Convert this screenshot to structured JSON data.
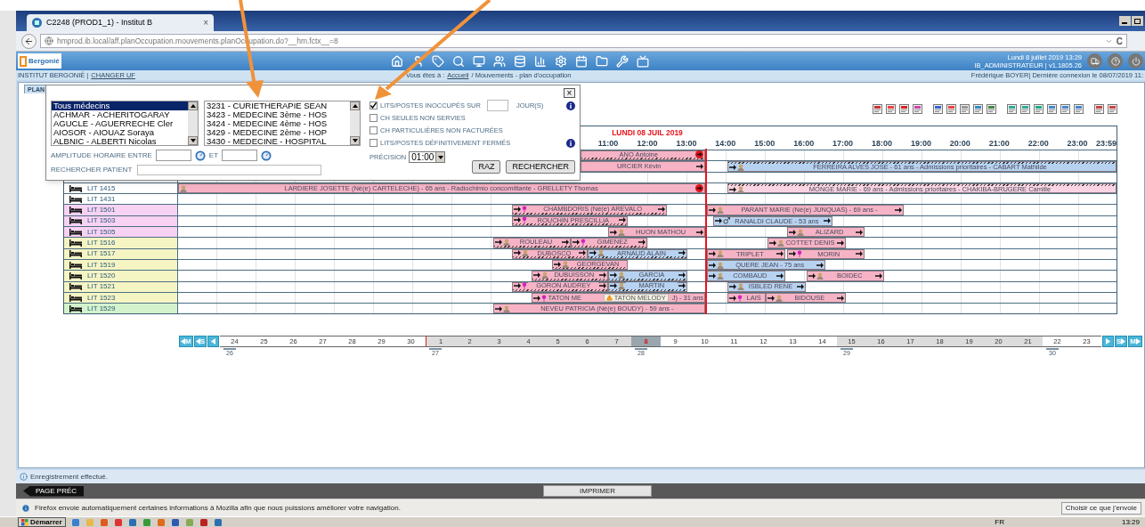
{
  "browser": {
    "tab_title": "C2248 (PROD1_1) - Institut B",
    "tab_close": "×",
    "url": "hmprod.ib.local/aff.planOccupation.mouvements.planOccupation.do?__hm.fctx__=8",
    "reload": "C"
  },
  "app_header": {
    "logo": "Bergonié",
    "date": "Lundi 8 juillet 2019 13:29",
    "user": "IB_ADMINISTRATEUR | v1.1805.26"
  },
  "breadcrumb": {
    "site": "INSTITUT BERGONIÉ |",
    "change_unit": "CHANGER UF",
    "location_prefix": "Vous êtes à :",
    "home_link": "Accueil",
    "location_rest": "/ Mouvements - plan d'occupation",
    "session": "Frédérique BOYER| Dernière connexion le 08/07/2019 11:"
  },
  "page_tab": "PLAN",
  "popup": {
    "close": "×",
    "doctors": [
      {
        "label": "Tous médecins",
        "selected": true
      },
      {
        "label": "ACHMAR - ACHERITOGARAY",
        "selected": false
      },
      {
        "label": "AGUCLE - AGUERRECHE Cler",
        "selected": false
      },
      {
        "label": "AIOSOR - AIOUAZ Soraya",
        "selected": false
      },
      {
        "label": "ALBNIC - ALBERTI Nicolas",
        "selected": false
      }
    ],
    "units": [
      {
        "label": "3231 - CURIETHERAPIE SEAN",
        "selected": false
      },
      {
        "label": "3423 - MEDECINE 3ème - HOS",
        "selected": false
      },
      {
        "label": "3424 - MEDECINE 4ème - HOS",
        "selected": false
      },
      {
        "label": "3429 - MEDECINE 2ème - HOP",
        "selected": false
      },
      {
        "label": "3430 - MEDECINE - HOSPITAL",
        "selected": false
      }
    ],
    "options": [
      {
        "label": "LITS/POSTES INOCCUPÉS SUR",
        "checked": true,
        "days_unit": "JOUR(S)",
        "info": true
      },
      {
        "label": "CH SEULES NON SERVIES",
        "checked": false,
        "info": false
      },
      {
        "label": "CH PARTICULIÈRES NON FACTURÉES",
        "checked": false,
        "info": false
      },
      {
        "label": "LITS/POSTES DÉFINITIVEMENT FERMÉS",
        "checked": false,
        "info": true
      }
    ],
    "amplitude_label": "AMPLITUDE HORAIRE ENTRE",
    "and_label": "ET",
    "patient_label": "RECHERCHER PATIENT",
    "precision_label": "PRÉCISION",
    "precision": "01:00",
    "buttons": [
      "RAZ",
      "RECHERCHER"
    ]
  },
  "grid": {
    "date": "LUNDI 08 JUIL 2019",
    "hours": [
      "11:00",
      "12:00",
      "13:00",
      "14:00",
      "15:00",
      "16:00",
      "17:00",
      "18:00",
      "19:00",
      "20:00",
      "21:00",
      "22:00",
      "23:00",
      "23:59"
    ],
    "rows": [
      {
        "bars": [
          {
            "text": "ANO Antoine",
            "color": "#f7b3c6",
            "hatch_top": false,
            "hatch_bottom": true,
            "arrow_in": false,
            "arrow_out": false,
            "kind": "plain",
            "stop": true
          }
        ]
      },
      {
        "bars": [
          {
            "text": "URCIER Kévin",
            "color": "#f7b3c6",
            "hatch_top": false,
            "hatch_bottom": false,
            "arrow_in": false,
            "arrow_out": true,
            "kind": "plain",
            "stop": false
          },
          {
            "text": "FERREIRA ALVES JOSE - 61 ans - Admissions prioritaires - CABART Mathilde",
            "color": "#b7d2f0",
            "hatch_top": true,
            "hatch_bottom": false,
            "arrow_in": true,
            "arrow_out": false,
            "kind": "person",
            "stop": false
          }
        ]
      },
      {
        "bars": []
      },
      {
        "label": "LIT 1415",
        "color": "#ffffff",
        "bars": [
          {
            "text": "LARDIERE JOSETTE (Né(e) CARTELECHE) - 65 ans - Radiochimio concomittante - GRELLETY Thomas",
            "color": "#f7b3c6",
            "hatch_top": false,
            "hatch_bottom": false,
            "arrow_in": false,
            "arrow_out": false,
            "kind": "person",
            "stop": true
          },
          {
            "text": "MONGE MARIE - 69 ans - Admissions prioritaires - CHAKIBA-BRUGERE Camille",
            "color": "#fad4e2",
            "hatch_top": true,
            "hatch_bottom": false,
            "arrow_in": true,
            "arrow_out": false,
            "kind": "person",
            "stop": false
          }
        ]
      },
      {
        "label": "LIT 1431",
        "color": "#ffffff",
        "bars": []
      },
      {
        "label": "LIT 1501",
        "color": "#f7d2f3",
        "bars": [
          {
            "text": "CHAMBDORIS (Né(e) AREVALO",
            "color": "#f7b3c6",
            "hatch_top": false,
            "hatch_bottom": true,
            "arrow_in": true,
            "arrow_out": true,
            "kind": "female",
            "stop": false
          },
          {
            "text": "PARANT MARIE (Né(e) JUNQUAS) - 69 ans -",
            "color": "#f7b3c6",
            "hatch_top": false,
            "hatch_bottom": false,
            "arrow_in": true,
            "arrow_out": true,
            "kind": "person",
            "stop": false
          }
        ]
      },
      {
        "label": "LIT 1503",
        "color": "#f7d2f3",
        "bars": [
          {
            "text": "ROUCHIN PRESCILLIA",
            "color": "#f7b3c6",
            "hatch_top": false,
            "hatch_bottom": true,
            "arrow_in": true,
            "arrow_out": true,
            "kind": "female",
            "stop": false
          },
          {
            "text": "RANALDI CLAUDE - 53 ans",
            "color": "#b7d2f0",
            "hatch_top": false,
            "hatch_bottom": false,
            "arrow_in": true,
            "arrow_out": true,
            "kind": "male",
            "stop": false
          }
        ]
      },
      {
        "label": "LIT 1505",
        "color": "#f7d2f3",
        "bars": [
          {
            "text": "HUON MATHOU",
            "color": "#f7b3c6",
            "hatch_top": false,
            "hatch_bottom": false,
            "arrow_in": true,
            "arrow_out": true,
            "kind": "person",
            "stop": false
          },
          {
            "text": "ALIZARD",
            "color": "#f7b3c6",
            "hatch_top": false,
            "hatch_bottom": false,
            "arrow_in": true,
            "arrow_out": true,
            "kind": "person",
            "stop": false
          }
        ]
      },
      {
        "label": "LIT 1516",
        "color": "#f5f5c4",
        "bars": [
          {
            "text": "ROULEAU",
            "color": "#f7b3c6",
            "hatch_top": false,
            "hatch_bottom": true,
            "arrow_in": true,
            "arrow_out": true,
            "kind": "person",
            "stop": false
          },
          {
            "text": "GIMENEZ",
            "color": "#f7b3c6",
            "hatch_top": false,
            "hatch_bottom": true,
            "arrow_in": true,
            "arrow_out": true,
            "kind": "female",
            "stop": false
          },
          {
            "text": "COTTET DENIS",
            "color": "#f7b3c6",
            "hatch_top": false,
            "hatch_bottom": false,
            "arrow_in": true,
            "arrow_out": true,
            "kind": "person",
            "stop": false
          }
        ]
      },
      {
        "label": "LIT 1517",
        "color": "#f5f5c4",
        "bars": [
          {
            "text": "DUBOSCQ",
            "color": "#f7b3c6",
            "hatch_top": false,
            "hatch_bottom": true,
            "arrow_in": true,
            "arrow_out": true,
            "kind": "person",
            "stop": false
          },
          {
            "text": "ARNAUD ALAIN",
            "color": "#b7d2f0",
            "hatch_top": false,
            "hatch_bottom": true,
            "arrow_in": true,
            "arrow_out": true,
            "kind": "person",
            "stop": false
          },
          {
            "text": "TRIPLET",
            "color": "#f7b3c6",
            "hatch_top": false,
            "hatch_bottom": false,
            "arrow_in": true,
            "arrow_out": true,
            "kind": "person",
            "stop": false
          },
          {
            "text": "MORIN",
            "color": "#f7b3c6",
            "hatch_top": false,
            "hatch_bottom": false,
            "arrow_in": true,
            "arrow_out": true,
            "kind": "female",
            "stop": false
          }
        ]
      },
      {
        "label": "LIT 1519",
        "color": "#f5f5c4",
        "bars": [
          {
            "text": "GEORGEVAN",
            "color": "#f7b3c6",
            "hatch_top": false,
            "hatch_bottom": true,
            "arrow_in": true,
            "arrow_out": false,
            "kind": "person",
            "stop": false
          },
          {
            "text": "QUERE JEAN - 75 ans",
            "color": "#b7d2f0",
            "hatch_top": false,
            "hatch_bottom": false,
            "arrow_in": true,
            "arrow_out": true,
            "kind": "person",
            "stop": false
          }
        ]
      },
      {
        "label": "LIT 1520",
        "color": "#f5f5c4",
        "bars": [
          {
            "text": "DUBUISSON",
            "color": "#f7b3c6",
            "hatch_top": false,
            "hatch_bottom": true,
            "arrow_in": true,
            "arrow_out": true,
            "kind": "person",
            "stop": false
          },
          {
            "text": "GARCIA",
            "color": "#b7d2f0",
            "hatch_top": false,
            "hatch_bottom": true,
            "arrow_in": true,
            "arrow_out": true,
            "kind": "person",
            "stop": false
          },
          {
            "text": "COMBAUD",
            "color": "#b7d2f0",
            "hatch_top": false,
            "hatch_bottom": false,
            "arrow_in": true,
            "arrow_out": true,
            "kind": "person",
            "stop": false
          },
          {
            "text": "BOIDEC",
            "color": "#f7b3c6",
            "hatch_top": false,
            "hatch_bottom": false,
            "arrow_in": true,
            "arrow_out": true,
            "kind": "person",
            "stop": false
          }
        ]
      },
      {
        "label": "LIT 1521",
        "color": "#f5f5c4",
        "bars": [
          {
            "text": "GORON AUDREY",
            "color": "#f7b3c6",
            "hatch_top": false,
            "hatch_bottom": true,
            "arrow_in": true,
            "arrow_out": true,
            "kind": "female",
            "stop": false
          },
          {
            "text": "MARTIN",
            "color": "#b7d2f0",
            "hatch_top": false,
            "hatch_bottom": true,
            "arrow_in": true,
            "arrow_out": true,
            "kind": "person",
            "stop": false
          },
          {
            "text": "ISBLED RENE",
            "color": "#b7d2f0",
            "hatch_top": false,
            "hatch_bottom": false,
            "arrow_in": true,
            "arrow_out": true,
            "kind": "person",
            "stop": false
          }
        ]
      },
      {
        "label": "LIT 1523",
        "color": "#f5f5c4",
        "bars": [
          {
            "text": "TATON ME",
            "warning": "TATON MELODY",
            "text_end": "J) - 31 ans",
            "color": "#f7b3c6",
            "hatch_top": false,
            "hatch_bottom": false,
            "arrow_in": true,
            "arrow_out": false,
            "kind": "female",
            "stop": false
          },
          {
            "text": "LAIS",
            "color": "#f7b3c6",
            "hatch_top": false,
            "hatch_bottom": false,
            "arrow_in": true,
            "arrow_out": false,
            "kind": "female",
            "stop": false
          },
          {
            "text": "BIDOUSE",
            "color": "#f7b3c6",
            "hatch_top": false,
            "hatch_bottom": false,
            "arrow_in": true,
            "arrow_out": true,
            "kind": "person",
            "stop": false
          }
        ]
      },
      {
        "label": "LIT 1529",
        "color": "#d4f3cd",
        "bars": [
          {
            "text": "NEVEU PATRICIA (Né(e) BOUDY) - 59 ans -",
            "color": "#f7b3c6",
            "hatch_top": false,
            "hatch_bottom": false,
            "arrow_in": true,
            "arrow_out": false,
            "kind": "person",
            "stop": false
          }
        ]
      }
    ]
  },
  "calendar": {
    "prev_month": "M",
    "prev_week": "S",
    "next_week": "S",
    "next_month": "M",
    "days": [
      {
        "label": "24",
        "shaded": false,
        "selected": false,
        "month_start": false,
        "week": "26"
      },
      {
        "label": "25",
        "shaded": false,
        "selected": false,
        "month_start": false
      },
      {
        "label": "26",
        "shaded": false,
        "selected": false,
        "month_start": false
      },
      {
        "label": "27",
        "shaded": false,
        "selected": false,
        "month_start": false
      },
      {
        "label": "28",
        "shaded": false,
        "selected": false,
        "month_start": false
      },
      {
        "label": "29",
        "shaded": false,
        "selected": false,
        "month_start": false
      },
      {
        "label": "30",
        "shaded": false,
        "selected": false,
        "month_start": false
      },
      {
        "label": "1",
        "shaded": true,
        "selected": false,
        "month_start": true,
        "week": "27"
      },
      {
        "label": "2",
        "shaded": true,
        "selected": false,
        "month_start": false
      },
      {
        "label": "3",
        "shaded": true,
        "selected": false,
        "month_start": false
      },
      {
        "label": "4",
        "shaded": true,
        "selected": false,
        "month_start": false
      },
      {
        "label": "5",
        "shaded": true,
        "selected": false,
        "month_start": false
      },
      {
        "label": "6",
        "shaded": true,
        "selected": false,
        "month_start": false
      },
      {
        "label": "7",
        "shaded": true,
        "selected": false,
        "month_start": false
      },
      {
        "label": "8",
        "shaded": false,
        "selected": true,
        "month_start": false,
        "week": "28"
      },
      {
        "label": "9",
        "shaded": false,
        "selected": false,
        "month_start": false
      },
      {
        "label": "10",
        "shaded": false,
        "selected": false,
        "month_start": false
      },
      {
        "label": "11",
        "shaded": false,
        "selected": false,
        "month_start": false
      },
      {
        "label": "12",
        "shaded": false,
        "selected": false,
        "month_start": false
      },
      {
        "label": "13",
        "shaded": false,
        "selected": false,
        "month_start": false
      },
      {
        "label": "14",
        "shaded": false,
        "selected": false,
        "month_start": false
      },
      {
        "label": "15",
        "shaded": true,
        "selected": false,
        "month_start": false,
        "week": "29"
      },
      {
        "label": "16",
        "shaded": true,
        "selected": false,
        "month_start": false
      },
      {
        "label": "17",
        "shaded": true,
        "selected": false,
        "month_start": false
      },
      {
        "label": "18",
        "shaded": true,
        "selected": false,
        "month_start": false
      },
      {
        "label": "19",
        "shaded": true,
        "selected": false,
        "month_start": false
      },
      {
        "label": "20",
        "shaded": true,
        "selected": false,
        "month_start": false
      },
      {
        "label": "21",
        "shaded": true,
        "selected": false,
        "month_start": false
      },
      {
        "label": "22",
        "shaded": false,
        "selected": false,
        "month_start": false,
        "week": "30"
      },
      {
        "label": "23",
        "shaded": false,
        "selected": false,
        "month_start": false
      }
    ]
  },
  "status": "Enregistrement effectué.",
  "footer_buttons": {
    "previous": "PAGE PRÉC",
    "print": "IMPRIMER"
  },
  "notification": {
    "text": "Firefox envoie automatiquement certaines informations à Mozilla afin que nous puissions améliorer votre navigation.",
    "button": "Choisir ce que j'envoie"
  },
  "taskbar": {
    "start": "Démarrer",
    "language": "FR",
    "clock": "13:29"
  }
}
